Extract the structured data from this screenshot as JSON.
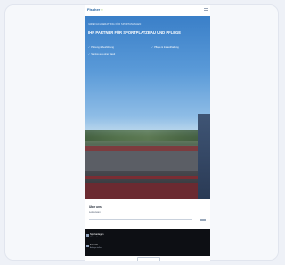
{
  "header": {
    "logo_text": "Fischer",
    "logo_mark": "●",
    "menu_icon": "hamburger-icon"
  },
  "hero": {
    "eyebrow": "IHRE FACHBERATUNG FÜR SPORTANLAGEN",
    "title": "IHR PARTNER FÜR SPORTPLATZBAU UND PFLEGE",
    "features": [
      "Planung & Ausführung",
      "Pflege & Instandhaltung",
      "Service aus einer Hand"
    ]
  },
  "info_card": {
    "title": "Über uns",
    "subtitle": "Leistungen"
  },
  "dark_section": {
    "rows": [
      {
        "title": "Sportanlagen",
        "sub": "Mehr erfahren"
      },
      {
        "title": "Kontakt",
        "sub": "Anfrage stellen"
      }
    ]
  },
  "colors": {
    "sky": "#3a7fc8",
    "track_red": "#7d3b3e",
    "dark_panel": "#0d0f14",
    "accent_green": "#7fbf2f"
  }
}
